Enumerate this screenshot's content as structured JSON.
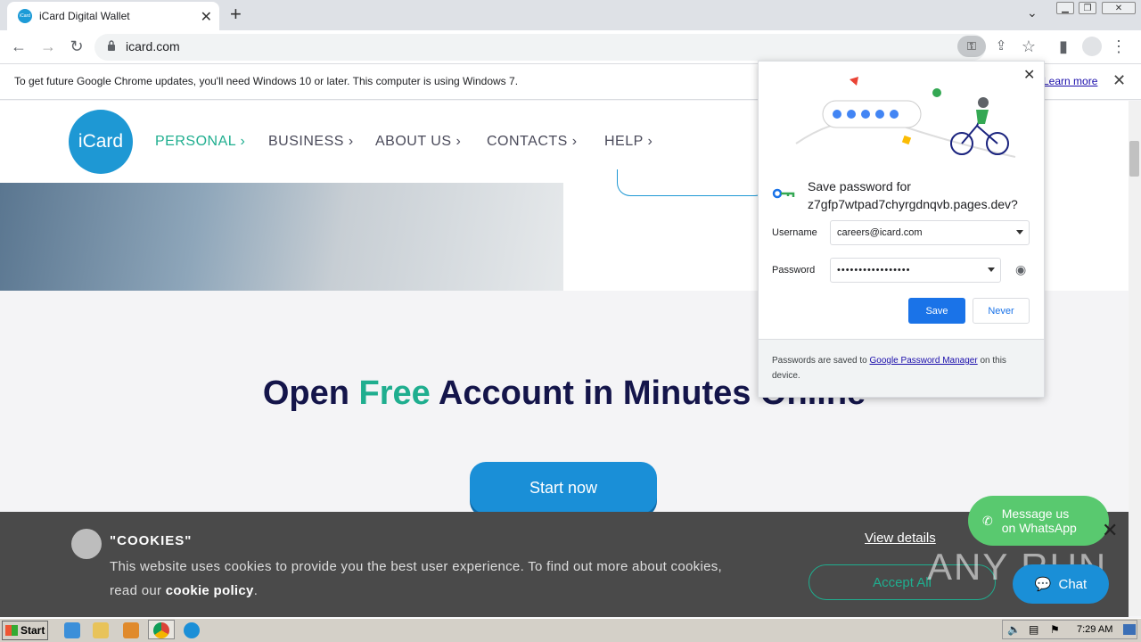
{
  "browser": {
    "tab_title": "iCard Digital Wallet",
    "tab_favicon": "iCard",
    "url": "icard.com",
    "infobar_text": "To get future Google Chrome updates, you'll need Windows 10 or later. This computer is using Windows 7.",
    "infobar_link": "Learn more"
  },
  "site": {
    "logo_text": "iCard",
    "nav": {
      "personal": "PERSONAL",
      "business": "BUSINESS",
      "about": "ABOUT US",
      "contacts": "CONTACTS",
      "help": "HELP"
    },
    "headline_part1": "Open ",
    "headline_free": "Free",
    "headline_part2": " Account in Minutes Online",
    "start_now": "Start now",
    "accent_color": "#1fae8f",
    "brand_color": "#1e98d4"
  },
  "cookie": {
    "title": "\"COOKIES\"",
    "text_before": "This website uses cookies to provide you the best user experience. To find out more about cookies, read our ",
    "policy_link": "cookie policy",
    "text_after": ".",
    "view_details": "View details",
    "accept": "Accept All"
  },
  "widgets": {
    "whatsapp_line1": "Message us",
    "whatsapp_line2": "on WhatsApp",
    "chat": "Chat"
  },
  "password_bubble": {
    "title_line1": "Save password for",
    "title_line2": "z7gfp7wtpad7chyrgdnqvb.pages.dev?",
    "username_label": "Username",
    "username_value": "careers@icard.com",
    "password_label": "Password",
    "password_value": "•••••••••••••••••",
    "save": "Save",
    "never": "Never",
    "footer_before": "Passwords are saved to ",
    "footer_link": "Google Password Manager",
    "footer_after": " on this device."
  },
  "taskbar": {
    "start": "Start",
    "clock": "7:29 AM"
  },
  "watermark": "ANY RUN"
}
